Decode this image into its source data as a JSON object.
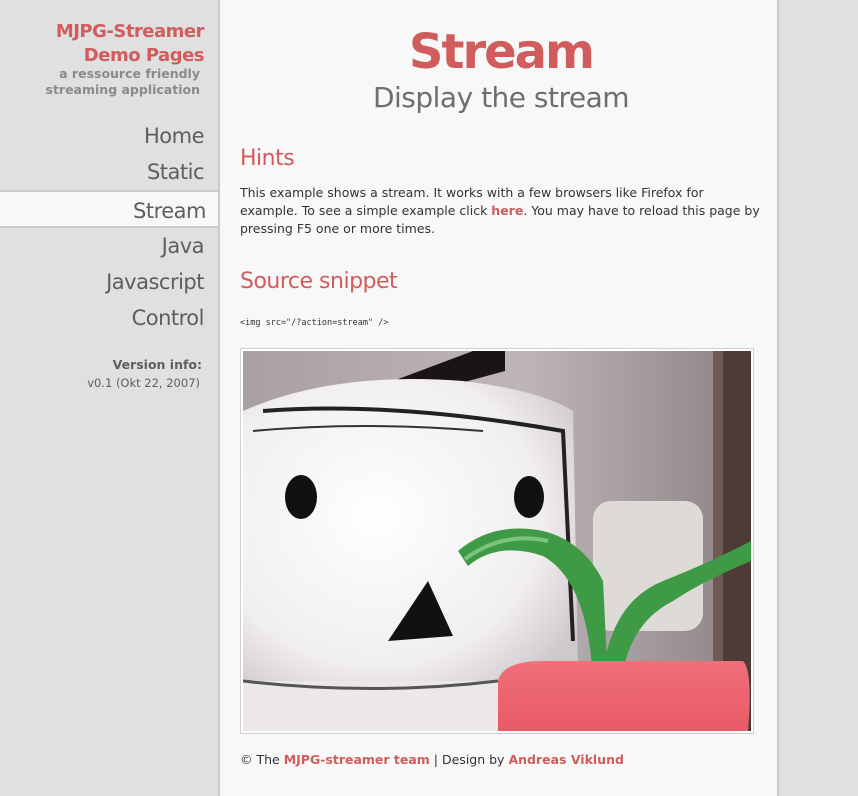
{
  "sidebar": {
    "site_title": "MJPG-Streamer\nDemo Pages",
    "site_subtitle": "a ressource friendly streaming application",
    "nav": [
      {
        "label": "Home",
        "active": false
      },
      {
        "label": "Static",
        "active": false
      },
      {
        "label": "Stream",
        "active": true
      },
      {
        "label": "Java",
        "active": false
      },
      {
        "label": "Javascript",
        "active": false
      },
      {
        "label": "Control",
        "active": false
      }
    ],
    "version_title": "Version info:",
    "version_value": "v0.1 (Okt 22, 2007)"
  },
  "main": {
    "title": "Stream",
    "subtitle": "Display the stream",
    "hints_heading": "Hints",
    "hints_text_before": "This example shows a stream. It works with a few browsers like Firefox for example. To see a simple example click ",
    "hints_link": "here",
    "hints_text_after": ". You may have to reload this page by pressing F5 one or more times.",
    "source_heading": "Source snippet",
    "code": "<img src=\"/?action=stream\" />",
    "stream_alt": "live webcam stream image"
  },
  "footer": {
    "prefix": "© The ",
    "team_link": "MJPG-streamer team",
    "separator": " | Design by ",
    "designer_link": "Andreas Viklund"
  },
  "colors": {
    "accent": "#d15c5c",
    "sidebar_bg": "#e0e0e0",
    "content_bg": "#f8f8f8",
    "nav_text": "#5e5e5e"
  }
}
